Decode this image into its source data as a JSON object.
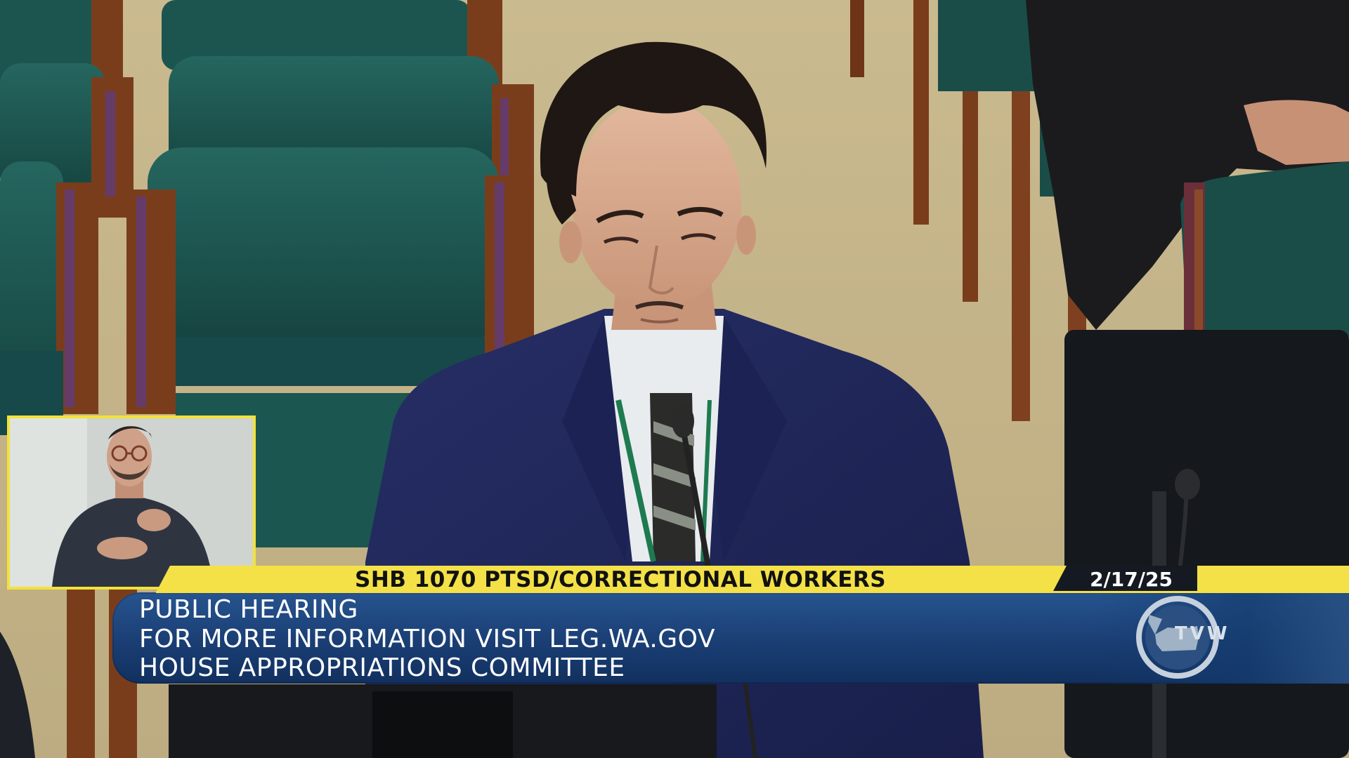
{
  "broadcast": {
    "bill_title": "SHB 1070 PTSD/CORRECTIONAL WORKERS",
    "date": "2/17/25",
    "info_lines": [
      "PUBLIC HEARING",
      "FOR MORE INFORMATION VISIT LEG.WA.GOV",
      "HOUSE APPROPRIATIONS COMMITTEE"
    ],
    "logo_text": "TVW",
    "logo_icon": "tvw-washington-logo"
  },
  "colors": {
    "title_bar": "#f3e147",
    "info_panel": "#1a3e74",
    "date_tab": "#151a22",
    "interpreter_border": "#f2e23a",
    "carpet": "#c9b98f",
    "chair_fabric": "#1f5a55",
    "chair_wood": "#7a3d1c",
    "suit": "#1f2556"
  }
}
